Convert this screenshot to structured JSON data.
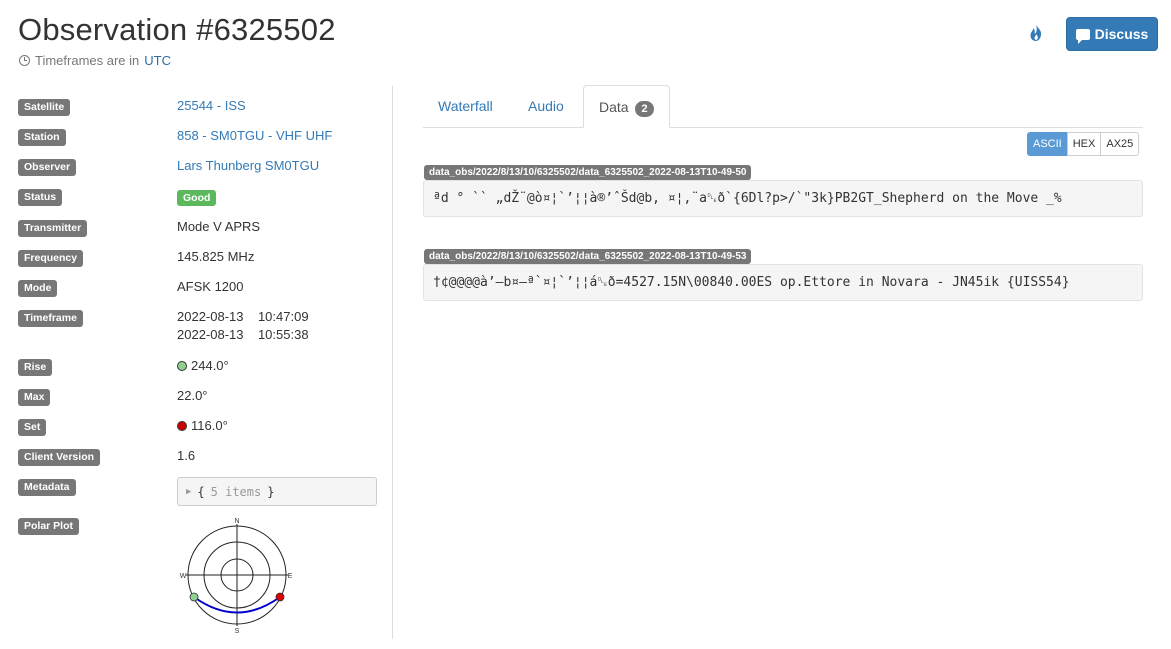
{
  "header": {
    "title": "Observation #6325502",
    "timeframe_note": "Timeframes are in",
    "timezone": "UTC",
    "discuss_label": "Discuss"
  },
  "details": {
    "satellite": {
      "label": "Satellite",
      "value": "25544 - ISS"
    },
    "station": {
      "label": "Station",
      "value": "858 - SM0TGU - VHF UHF"
    },
    "observer": {
      "label": "Observer",
      "value": "Lars Thunberg SM0TGU"
    },
    "status": {
      "label": "Status",
      "value": "Good",
      "color": "#5cb85c"
    },
    "transmitter": {
      "label": "Transmitter",
      "value": "Mode V APRS"
    },
    "frequency": {
      "label": "Frequency",
      "value": "145.825 MHz"
    },
    "mode": {
      "label": "Mode",
      "value": "AFSK 1200"
    },
    "timeframe": {
      "label": "Timeframe",
      "start": "2022-08-13    10:47:09",
      "end": "2022-08-13    10:55:38"
    },
    "rise": {
      "label": "Rise",
      "value": "244.0°",
      "color": "#8fd18f"
    },
    "max": {
      "label": "Max",
      "value": "22.0°"
    },
    "set": {
      "label": "Set",
      "value": "116.0°",
      "color": "#cc0000"
    },
    "client_version": {
      "label": "Client Version",
      "value": "1.6"
    },
    "metadata": {
      "label": "Metadata",
      "open": "{",
      "count": "5 items",
      "close": "}"
    },
    "polar_plot": {
      "label": "Polar Plot",
      "n": "N",
      "s": "S",
      "e": "E",
      "w": "W",
      "track_color": "#0000cc"
    }
  },
  "tabs": [
    {
      "label": "Waterfall"
    },
    {
      "label": "Audio"
    },
    {
      "label": "Data",
      "badge": "2"
    }
  ],
  "formats": [
    "ASCII",
    "HEX",
    "AX25"
  ],
  "data_frames": [
    {
      "filename": "data_obs/2022/8/13/10/6325502/data_6325502_2022-08-13T10-49-50",
      "content": "ªd ° `` „dŽ¨@ò¤¦`’¦¦à®’ˆŠd@b, ¤¦,¨a␐ð`{6Dl?p>/`\"3k}PB2GT_Shepherd on the Move _%"
    },
    {
      "filename": "data_obs/2022/8/13/10/6325502/data_6325502_2022-08-13T10-49-53",
      "content": "†¢@@@@à’–b¤–ª`¤¦`’¦¦á␐ð=4527.15N\\00840.00ES op.Ettore in Novara - JN45ik {UISS54}"
    }
  ]
}
